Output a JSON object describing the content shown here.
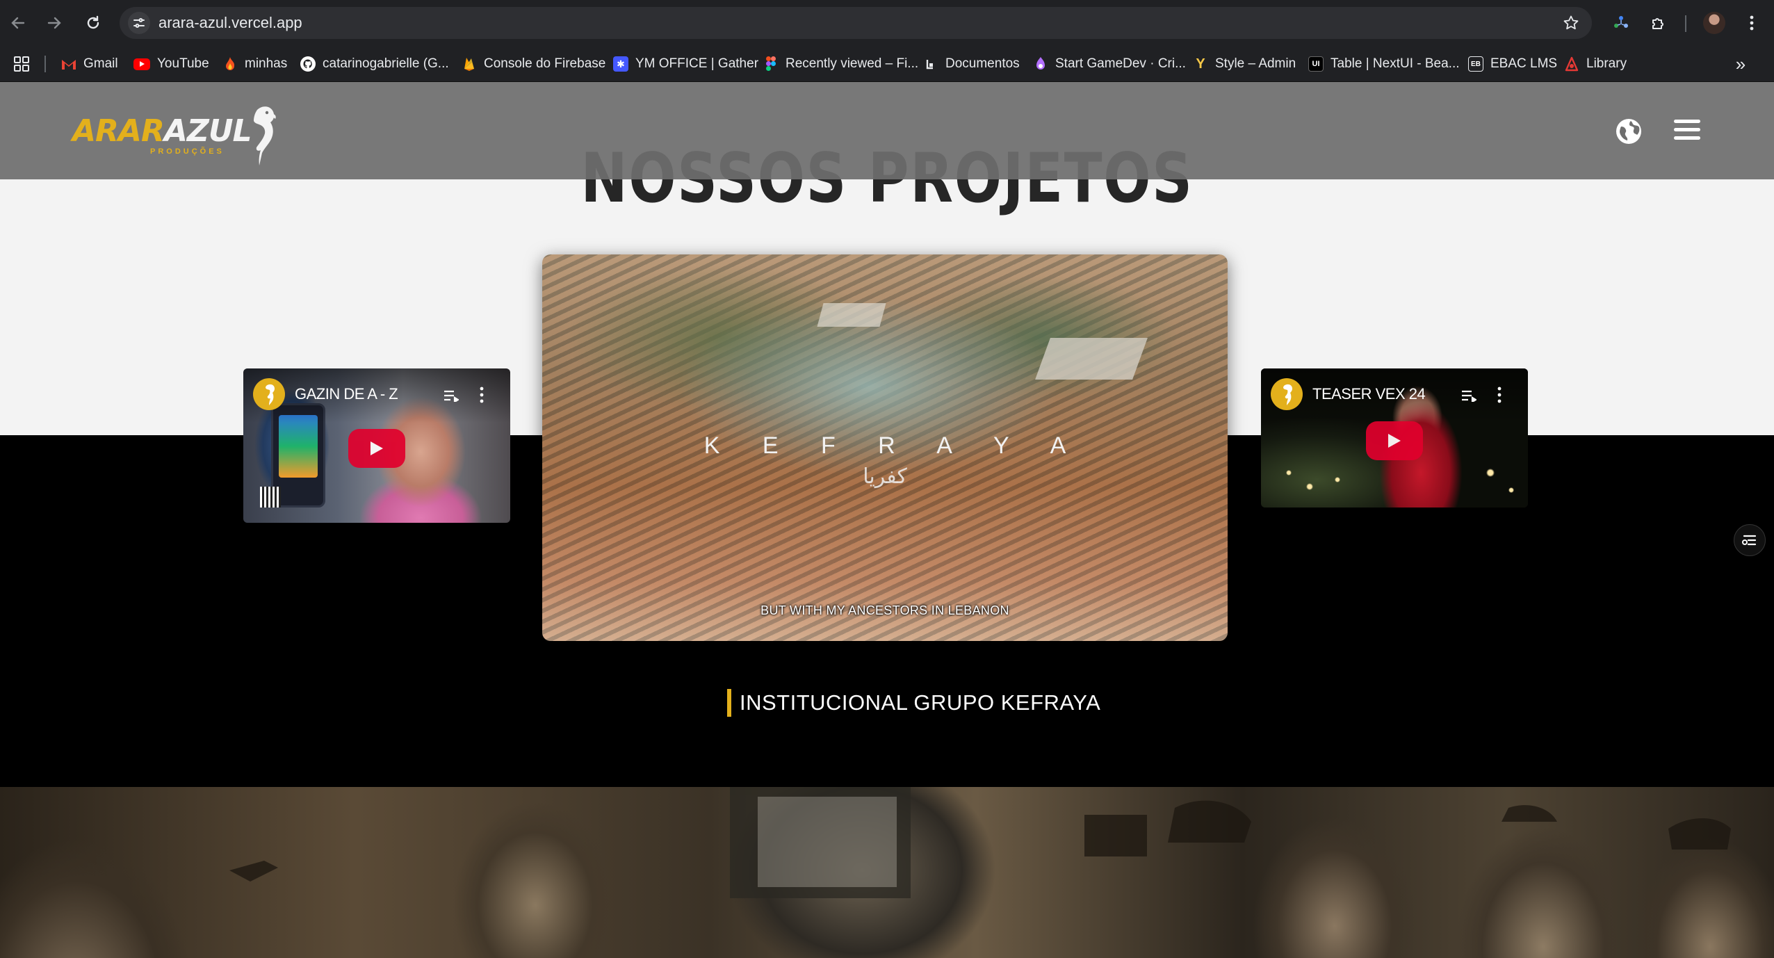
{
  "browser": {
    "url": "arara-azul.vercel.app",
    "bookmarks": [
      {
        "label": "Gmail",
        "icon": "gmail-icon",
        "color": "#ea4335"
      },
      {
        "label": "YouTube",
        "icon": "youtube-icon",
        "color": "#ff0000"
      },
      {
        "label": "minhas",
        "icon": "firebase-flame-icon",
        "color": "#f4511e"
      },
      {
        "label": "catarinogabrielle (G...",
        "icon": "github-icon",
        "color": "#ffffff"
      },
      {
        "label": "Console do Firebase",
        "icon": "firebase-icon",
        "color": "#ffa000"
      },
      {
        "label": "YM OFFICE | Gather",
        "icon": "gather-icon",
        "color": "#4458ff"
      },
      {
        "label": "Recently viewed – Fi...",
        "icon": "figma-icon",
        "color": "#a259ff"
      },
      {
        "label": "Documentos",
        "icon": "documents-icon",
        "color": "#e8eaed"
      },
      {
        "label": "Start GameDev · Cri...",
        "icon": "gamedev-icon",
        "color": "#b36fff"
      },
      {
        "label": "Style – Admin",
        "icon": "style-y-icon",
        "color": "#f7c948"
      },
      {
        "label": "Table | NextUI - Bea...",
        "icon": "nextui-icon",
        "color": "#111111"
      },
      {
        "label": "EBAC LMS",
        "icon": "ebac-icon",
        "color": "#e8eaed"
      },
      {
        "label": "Library",
        "icon": "library-icon",
        "color": "#e53935"
      }
    ]
  },
  "site": {
    "logo_part1": "ARAR",
    "logo_part2": "AZUL",
    "logo_sub": "PRODUÇÕES",
    "accent": "#e3b01c",
    "section_title": "NOSSOS PROJETOS",
    "videos": {
      "left": {
        "title": "GAZIN DE A - Z"
      },
      "main": {
        "title": "K E F R A Y A",
        "arabic": "كفريا",
        "subtitle": "BUT WITH MY ANCESTORS IN LEBANON"
      },
      "right": {
        "title": "TEASER VEX 24"
      }
    },
    "caption": "INSTITUCIONAL GRUPO KEFRAYA"
  }
}
